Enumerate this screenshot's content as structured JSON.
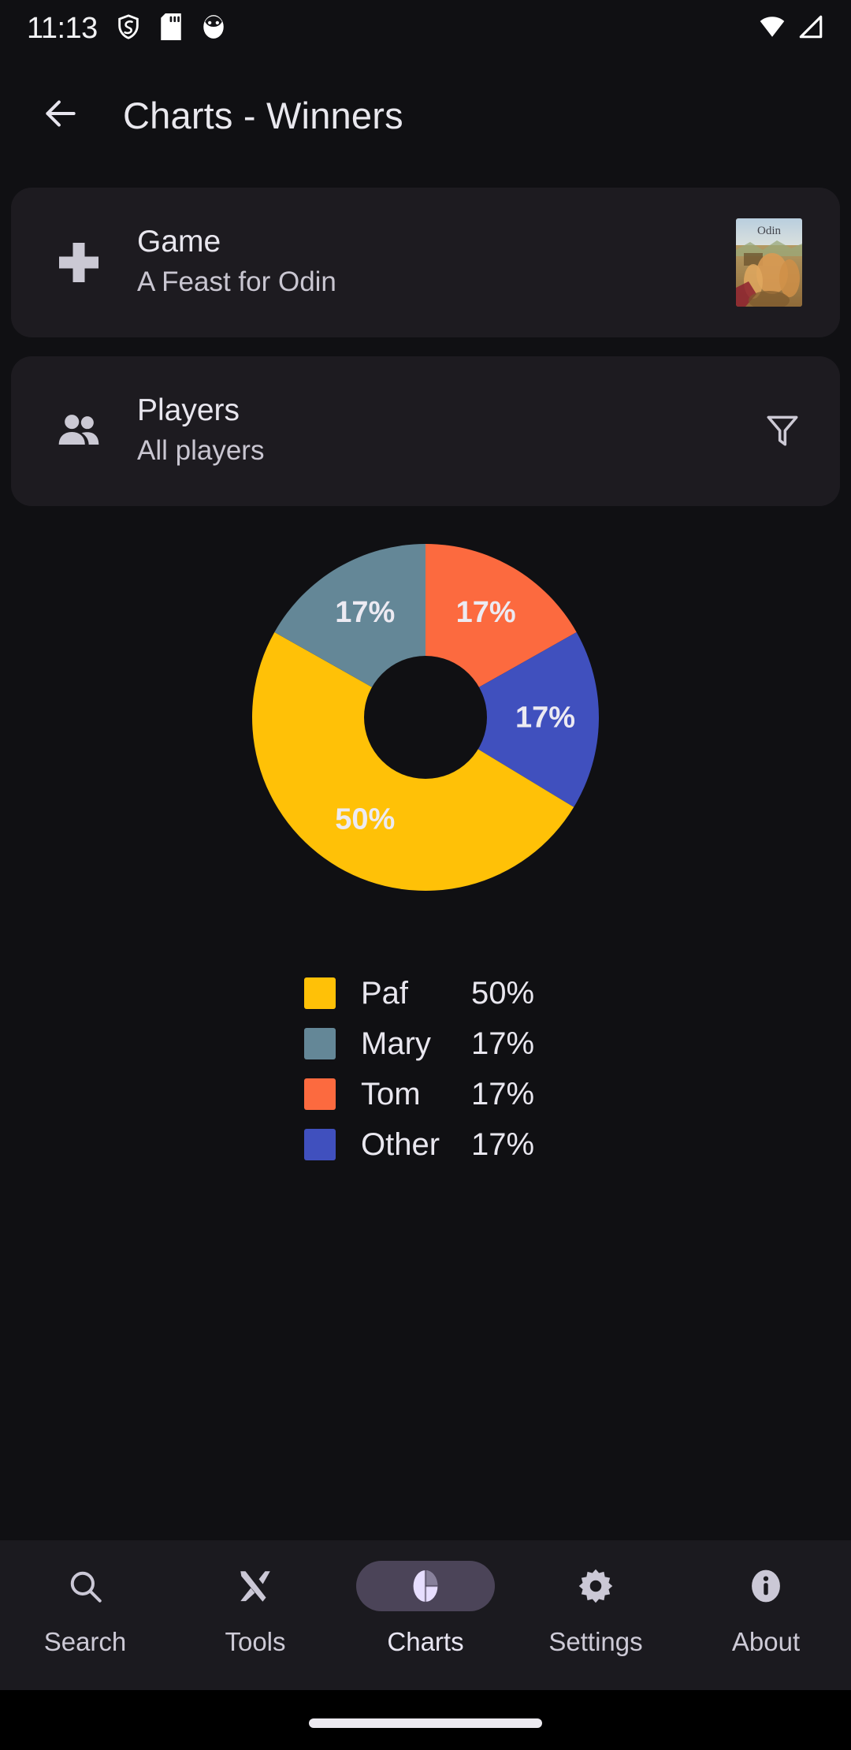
{
  "status_bar": {
    "time": "11:13",
    "left_icons": [
      "shield-icon",
      "sd-card-icon",
      "app-badge-icon"
    ],
    "right_icons": [
      "wifi-icon",
      "cell-signal-icon"
    ]
  },
  "app_bar": {
    "back_icon": "back-arrow-icon",
    "title": "Charts - Winners"
  },
  "cards": {
    "game": {
      "icon": "gamepad-dpad-icon",
      "title": "Game",
      "subtitle": "A Feast for Odin",
      "thumbnail": "game-box-art"
    },
    "players": {
      "icon": "people-icon",
      "title": "Players",
      "subtitle": "All players",
      "action_icon": "filter-funnel-icon"
    }
  },
  "chart_data": {
    "type": "pie",
    "title": "Charts - Winners",
    "subtype": "donut",
    "categories": [
      "Paf",
      "Mary",
      "Tom",
      "Other"
    ],
    "values": [
      50,
      17,
      17,
      17
    ],
    "value_labels": [
      "50%",
      "17%",
      "17%",
      "17%"
    ],
    "colors": [
      "#FFC107",
      "#648797",
      "#FC6A3F",
      "#4050BE"
    ],
    "legend_position": "bottom",
    "legend": [
      {
        "name": "Paf",
        "percent": "50%",
        "color": "#FFC107"
      },
      {
        "name": "Mary",
        "percent": "17%",
        "color": "#648797"
      },
      {
        "name": "Tom",
        "percent": "17%",
        "color": "#FC6A3F"
      },
      {
        "name": "Other",
        "percent": "17%",
        "color": "#4050BE"
      }
    ],
    "slice_labels": [
      {
        "text": "50%",
        "color": "#FFC107"
      },
      {
        "text": "17%",
        "color": "#648797"
      },
      {
        "text": "17%",
        "color": "#FC6A3F"
      },
      {
        "text": "17%",
        "color": "#4050BE"
      }
    ]
  },
  "bottom_nav": {
    "active": "Charts",
    "items": [
      {
        "label": "Search",
        "icon": "search-icon"
      },
      {
        "label": "Tools",
        "icon": "tools-icon"
      },
      {
        "label": "Charts",
        "icon": "pie-chart-icon"
      },
      {
        "label": "Settings",
        "icon": "gear-icon"
      },
      {
        "label": "About",
        "icon": "info-icon"
      }
    ]
  },
  "theme": {
    "background": "#101013",
    "card_background": "#1d1b20",
    "nav_background": "#1b1a1f",
    "active_pill": "#4b4458",
    "text_primary": "#e9e7ef"
  }
}
